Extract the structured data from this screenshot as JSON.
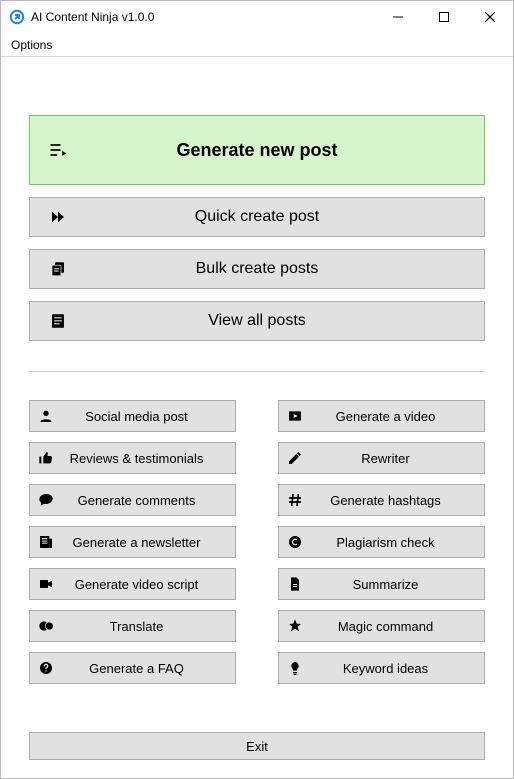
{
  "window": {
    "title": "AI Content Ninja v1.0.0"
  },
  "menubar": {
    "options": "Options"
  },
  "top_buttons": {
    "primary": {
      "label": "Generate new post",
      "icon": "playlist"
    },
    "items": [
      {
        "label": "Quick create post",
        "icon": "fast-forward"
      },
      {
        "label": "Bulk create posts",
        "icon": "copy"
      },
      {
        "label": "View all posts",
        "icon": "article"
      }
    ]
  },
  "tools_left": [
    {
      "label": "Social media post",
      "icon": "person"
    },
    {
      "label": "Reviews & testimonials",
      "icon": "thumbs-up"
    },
    {
      "label": "Generate comments",
      "icon": "chat"
    },
    {
      "label": "Generate a newsletter",
      "icon": "newspaper"
    },
    {
      "label": "Generate video script",
      "icon": "video"
    },
    {
      "label": "Translate",
      "icon": "globe"
    },
    {
      "label": "Generate a FAQ",
      "icon": "help"
    }
  ],
  "tools_right": [
    {
      "label": "Generate a video",
      "icon": "play"
    },
    {
      "label": "Rewriter",
      "icon": "pencil"
    },
    {
      "label": "Generate hashtags",
      "icon": "hash"
    },
    {
      "label": "Plagiarism check",
      "icon": "copyright"
    },
    {
      "label": "Summarize",
      "icon": "file"
    },
    {
      "label": "Magic command",
      "icon": "star"
    },
    {
      "label": "Keyword ideas",
      "icon": "bulb"
    }
  ],
  "footer": {
    "exit": "Exit"
  }
}
